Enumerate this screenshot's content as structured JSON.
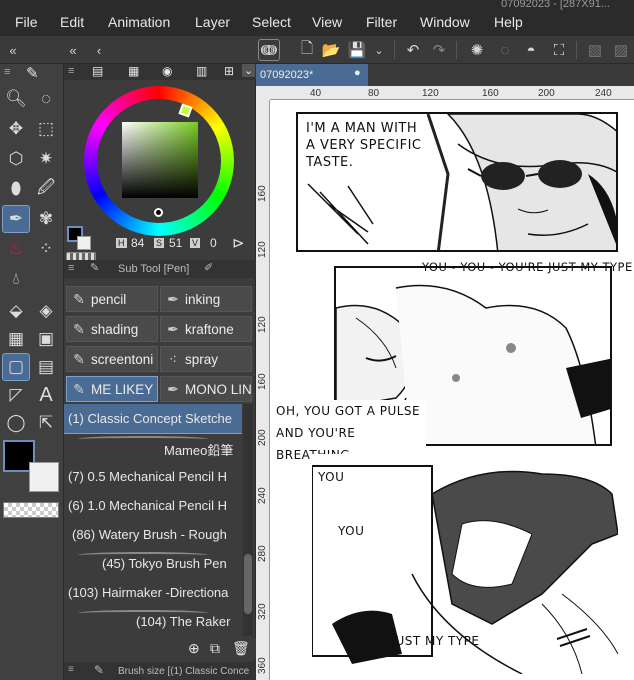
{
  "window": {
    "title_fragment": "07092023 - [287X91..."
  },
  "menu": [
    "File",
    "Edit",
    "Animation",
    "Layer",
    "Select",
    "View",
    "Filter",
    "Window",
    "Help"
  ],
  "toolbar_icons": [
    "collapse-left-icon",
    "new-icon",
    "open-icon",
    "save-icon",
    "undo-icon",
    "redo-icon",
    "loading-icon",
    "fill-icon",
    "transform-icon",
    "grid-icon"
  ],
  "tools": [
    "zoom",
    "lasso",
    "move",
    "marquee",
    "object",
    "wand",
    "eyedropper",
    "pen",
    "brush",
    "decoration",
    "blend",
    "eraser",
    "fill",
    "gradient",
    "figure",
    "frame",
    "ruler",
    "text",
    "balloon",
    "correct-line"
  ],
  "color": {
    "h_label": "H",
    "h": "84",
    "s_label": "S",
    "s": "51",
    "v_label": "V",
    "v": "0",
    "selected_hex": "#000000"
  },
  "subtool": {
    "header": "Sub Tool [Pen]",
    "items": [
      {
        "label": "pencil"
      },
      {
        "label": "inking"
      },
      {
        "label": "shading"
      },
      {
        "label": "kraftone"
      },
      {
        "label": "screentoni"
      },
      {
        "label": "spray"
      },
      {
        "label": "ME LIKEY"
      },
      {
        "label": "MONO LIN"
      }
    ]
  },
  "brushes": [
    {
      "label": "(1) Classic Concept Sketche"
    },
    {
      "label": "Mameo鉛筆"
    },
    {
      "label": "(7) 0.5 Mechanical Pencil H"
    },
    {
      "label": "(6) 1.0 Mechanical Pencil H"
    },
    {
      "label": "(86) Watery Brush - Rough"
    },
    {
      "label": "(45) Tokyo Brush Pen"
    },
    {
      "label": "(103) Hairmaker -Directiona"
    },
    {
      "label": "(104) The Raker"
    }
  ],
  "brush_size_header": "Brush size [(1) Classic Conce",
  "document": {
    "tab": "07092023*",
    "ruler_h": [
      "40",
      "80",
      "120",
      "160",
      "200",
      "240"
    ],
    "ruler_v": [
      "160",
      "120",
      "80",
      "120",
      "160",
      "200",
      "240",
      "280",
      "320",
      "360"
    ]
  },
  "comic": {
    "panel1_text": "I'M A MAN WITH A VERY SPECIFIC TASTE.",
    "panel2_text": "YOU - YOU - YOU'RE JUST MY TYPE",
    "panel2_text_b": "OH, YOU GOT A PULSE AND YOU'RE BREATHING",
    "panel3_you1": "YOU",
    "panel3_you2": "YOU",
    "panel3_text": "YOU'RE JUST MY TYPE"
  }
}
